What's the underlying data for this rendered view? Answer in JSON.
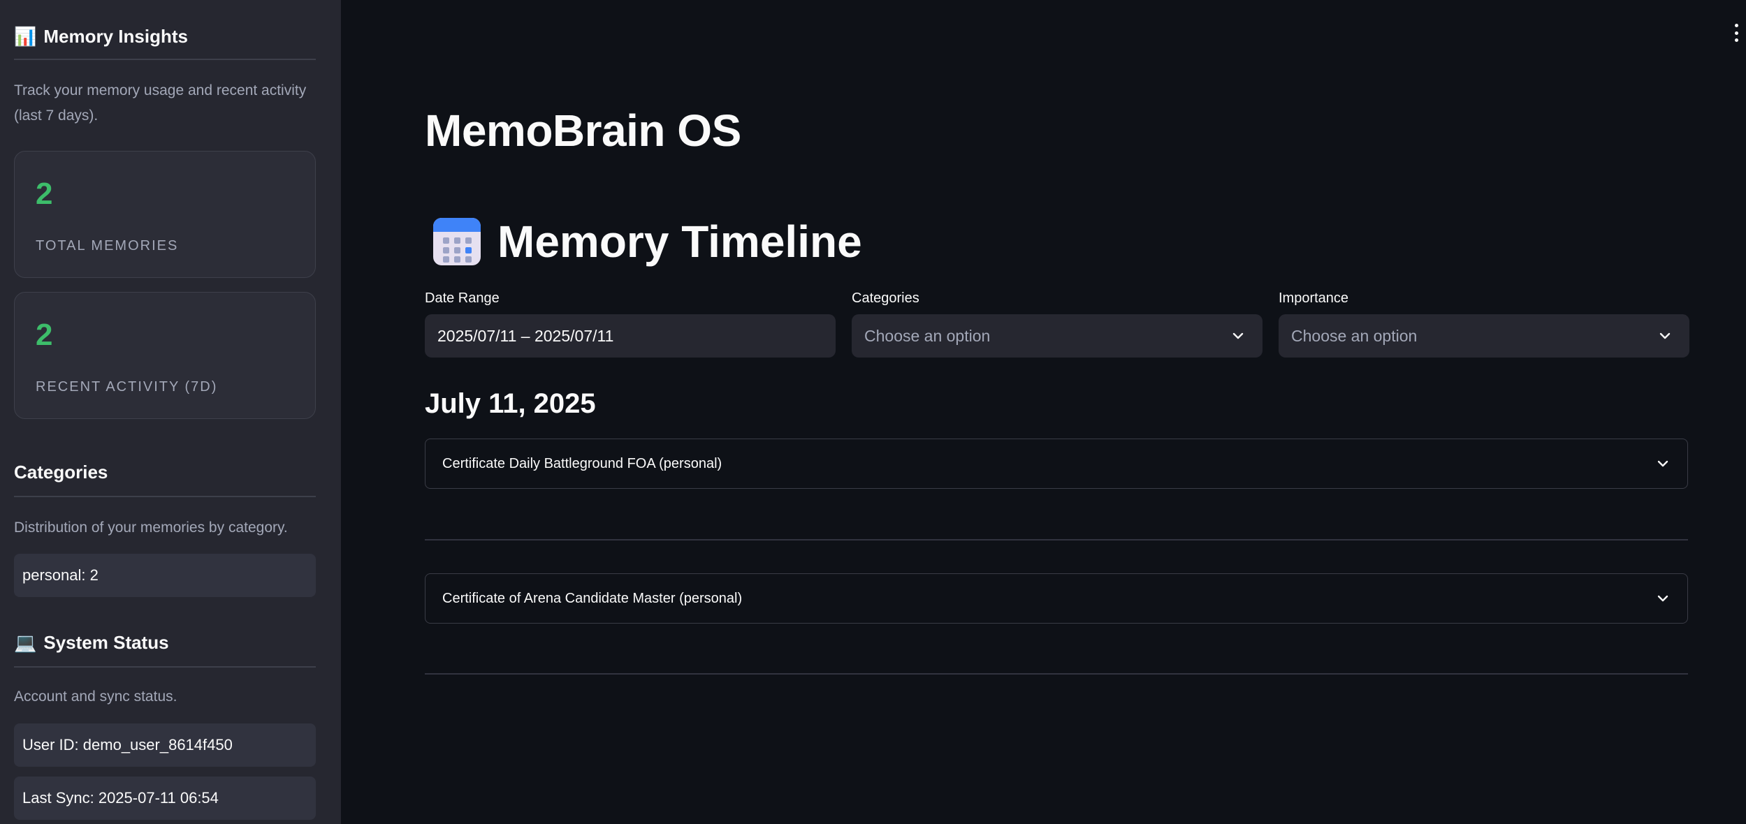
{
  "sidebar": {
    "insights": {
      "icon": "bar-chart-icon",
      "icon_glyph": "📊",
      "title": "Memory Insights",
      "caption": "Track your memory usage and recent activity (last 7 days).",
      "metrics": [
        {
          "value": "2",
          "label": "TOTAL MEMORIES"
        },
        {
          "value": "2",
          "label": "RECENT ACTIVITY (7D)"
        }
      ]
    },
    "categories": {
      "title": "Categories",
      "caption": "Distribution of your memories by category.",
      "items": [
        {
          "label": "personal: 2"
        }
      ]
    },
    "system": {
      "icon": "laptop-icon",
      "icon_glyph": "💻",
      "title": "System Status",
      "caption": "Account and sync status.",
      "user_id": "User ID: demo_user_8614f450",
      "last_sync": "Last Sync: 2025-07-11 06:54"
    }
  },
  "main": {
    "app_title": "MemoBrain OS",
    "timeline_title": "Memory Timeline",
    "timeline_icon": "calendar-icon",
    "filters": {
      "date_range": {
        "label": "Date Range",
        "value": "2025/07/11 – 2025/07/11"
      },
      "categories": {
        "label": "Categories",
        "placeholder": "Choose an option"
      },
      "importance": {
        "label": "Importance",
        "placeholder": "Choose an option"
      }
    },
    "date_group": {
      "date": "July 11, 2025",
      "entries": [
        {
          "title": "Certificate Daily Battleground FOA (personal)"
        },
        {
          "title": "Certificate of Arena Candidate Master (personal)"
        }
      ]
    }
  },
  "colors": {
    "background": "#0e1117",
    "sidebar": "#262730",
    "metric_accent": "#3dbd6a",
    "muted_text": "#a3a8b8"
  }
}
